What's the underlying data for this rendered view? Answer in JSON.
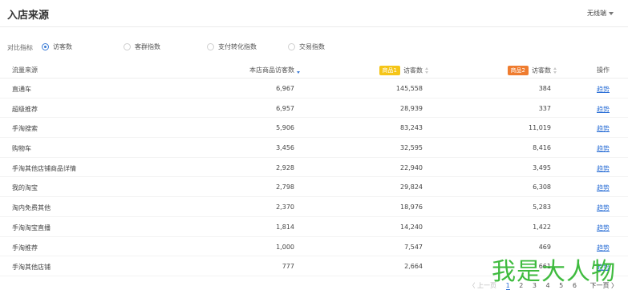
{
  "header": {
    "title": "入店来源",
    "device": "无线端"
  },
  "metric": {
    "label": "对比指标",
    "options": [
      {
        "label": "访客数",
        "checked": true
      },
      {
        "label": "客群指数",
        "checked": false
      },
      {
        "label": "支付转化指数",
        "checked": false
      },
      {
        "label": "交易指数",
        "checked": false
      }
    ]
  },
  "table": {
    "headers": {
      "source": "流量来源",
      "own": "本店商品访客数",
      "g1_tag": "商品1",
      "g1": "访客数",
      "g2_tag": "商品2",
      "g2": "访客数",
      "action": "操作"
    },
    "rows": [
      {
        "source": "直通车",
        "own": "6,967",
        "g1": "145,558",
        "g2": "384",
        "action": "趋势"
      },
      {
        "source": "超级推荐",
        "own": "6,957",
        "g1": "28,939",
        "g2": "337",
        "action": "趋势"
      },
      {
        "source": "手淘搜索",
        "own": "5,906",
        "g1": "83,243",
        "g2": "11,019",
        "action": "趋势"
      },
      {
        "source": "购物车",
        "own": "3,456",
        "g1": "32,595",
        "g2": "8,416",
        "action": "趋势"
      },
      {
        "source": "手淘其他店铺商品详情",
        "own": "2,928",
        "g1": "22,940",
        "g2": "3,495",
        "action": "趋势"
      },
      {
        "source": "我的淘宝",
        "own": "2,798",
        "g1": "29,824",
        "g2": "6,308",
        "action": "趋势"
      },
      {
        "source": "淘内免费其他",
        "own": "2,370",
        "g1": "18,976",
        "g2": "5,283",
        "action": "趋势"
      },
      {
        "source": "手淘淘宝直播",
        "own": "1,814",
        "g1": "14,240",
        "g2": "1,422",
        "action": "趋势"
      },
      {
        "source": "手淘推荐",
        "own": "1,000",
        "g1": "7,547",
        "g2": "469",
        "action": "趋势"
      },
      {
        "source": "手淘其他店铺",
        "own": "777",
        "g1": "2,664",
        "g2": "661",
        "action": "趋势"
      }
    ]
  },
  "pager": {
    "prev": "〈 上一页",
    "pages": [
      "1",
      "2",
      "3",
      "4",
      "5",
      "6"
    ],
    "current": "1",
    "next": "下一页 〉"
  },
  "watermark": "我是大人物",
  "colors": {
    "accent": "#2b6fd6",
    "tag1": "#f5c518",
    "tag2": "#ef7c2f",
    "watermark": "#2fb62f"
  }
}
